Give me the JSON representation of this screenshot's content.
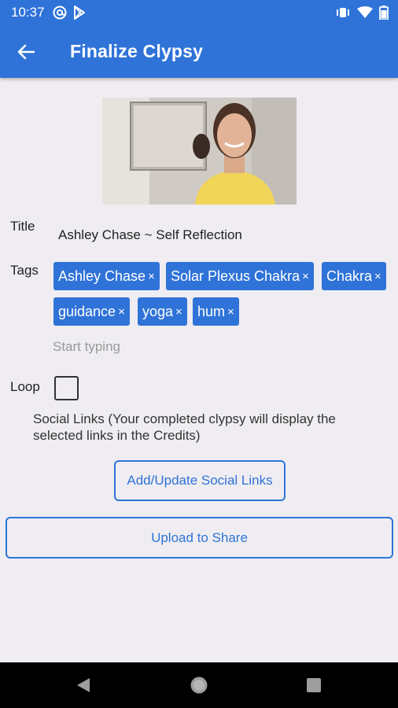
{
  "status_bar": {
    "time": "10:37",
    "left_icons": [
      "at-sign-icon",
      "play-store-icon"
    ],
    "right_icons": [
      "vibrate-icon",
      "wifi-icon",
      "battery-icon"
    ]
  },
  "app_bar": {
    "title": "Finalize Clypsy",
    "back_icon": "arrow-left-icon"
  },
  "form": {
    "title_label": "Title",
    "title_value": "Ashley Chase ~ Self Reflection",
    "tags_label": "Tags",
    "tags": [
      {
        "label": "Ashley Chase",
        "remove": "×"
      },
      {
        "label": "Solar Plexus Chakra",
        "remove": "×"
      },
      {
        "label": "Chakra",
        "remove": "×"
      },
      {
        "label": "guidance",
        "remove": "×"
      },
      {
        "label": "yoga",
        "remove": "×"
      },
      {
        "label": "hum",
        "remove": "×"
      }
    ],
    "tag_placeholder": "Start typing",
    "loop_label": "Loop",
    "loop_checked": false,
    "social_text": "Social Links (Your completed clypsy will display the selected links in the Credits)",
    "social_button": "Add/Update Social Links",
    "upload_button": "Upload to Share"
  },
  "nav_bar": {
    "back": "nav-back-icon",
    "home": "nav-home-icon",
    "recents": "nav-recents-icon"
  },
  "colors": {
    "primary": "#2f73d8",
    "background": "#efedf1"
  }
}
